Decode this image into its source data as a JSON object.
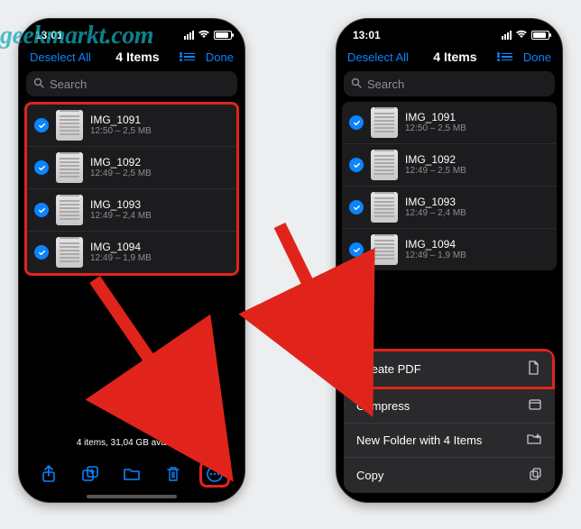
{
  "watermark": "geekmarkt.com",
  "status": {
    "time": "13:01"
  },
  "nav": {
    "deselect": "Deselect All",
    "title": "4 Items",
    "done": "Done"
  },
  "search": {
    "placeholder": "Search"
  },
  "files": [
    {
      "name": "IMG_1091",
      "meta": "12:50 – 2,5 MB"
    },
    {
      "name": "IMG_1092",
      "meta": "12:49 – 2,5 MB"
    },
    {
      "name": "IMG_1093",
      "meta": "12:49 – 2,4 MB"
    },
    {
      "name": "IMG_1094",
      "meta": "12:49 – 1,9 MB"
    }
  ],
  "footer": {
    "info": "4 items, 31,04 GB available"
  },
  "menu": {
    "create_pdf": "Create PDF",
    "compress": "Compress",
    "new_folder": "New Folder with 4 Items",
    "copy": "Copy"
  }
}
